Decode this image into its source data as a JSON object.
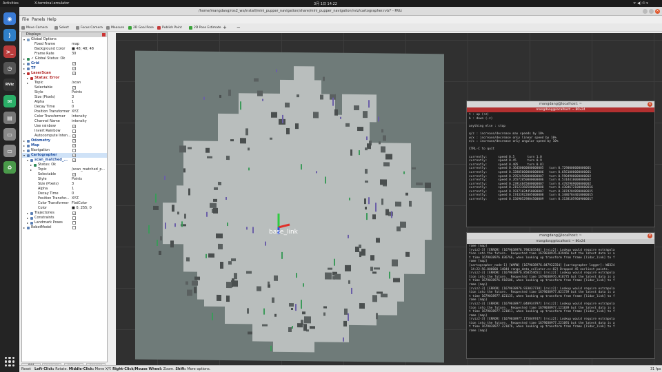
{
  "topbar": {
    "activities": "Activities",
    "app": "X-terminal-emulator",
    "clock": "3月 1日 14:22",
    "right_icons": "ᯤ ◀) ⏻ ▾"
  },
  "dock": {
    "items": [
      {
        "name": "chrome-icon",
        "glyph": "◉",
        "color": "#3a7bd5"
      },
      {
        "name": "vscode-icon",
        "glyph": "⟩",
        "color": "#2f7fc8"
      },
      {
        "name": "terminal-icon",
        "glyph": ">_",
        "color": "#b93c3c"
      },
      {
        "name": "clock-icon",
        "glyph": "◷",
        "color": "#555"
      },
      {
        "name": "rviz-icon",
        "glyph": "RViz",
        "color": "#333"
      },
      {
        "name": "wechat-icon",
        "glyph": "✉",
        "color": "#2aae67"
      },
      {
        "name": "files-icon",
        "glyph": "▤",
        "color": "#777"
      },
      {
        "name": "drive-icon",
        "glyph": "▭",
        "color": "#888"
      },
      {
        "name": "drive-icon-2",
        "glyph": "▭",
        "color": "#888"
      },
      {
        "name": "trash-icon",
        "glyph": "♻",
        "color": "#4a9a4a"
      }
    ]
  },
  "window": {
    "title": "/home/mangdang/ros2_ws/install/mini_pupper_navigation/share/mini_pupper_navigation/rviz/cartographer.rviz* - RViz"
  },
  "menu": {
    "file": "File",
    "panels": "Panels",
    "help": "Help"
  },
  "toolbar": {
    "items": [
      "Move Camera",
      "Select",
      "Focus Camera",
      "Measure",
      "2D Goal Pose",
      "Publish Point",
      "2D Pose Estimate",
      "+",
      "−"
    ],
    "colors": [
      "#888888",
      "#888888",
      "#888888",
      "#888888",
      "#3aa33a",
      "#c43b3b",
      "#3aa33a",
      "#333333",
      "#333333"
    ]
  },
  "displays": {
    "title": "Displays",
    "rows": [
      {
        "indent": 1,
        "arrow": "▾",
        "icon": "#7a9cc2",
        "label": "Global Options",
        "value": ""
      },
      {
        "indent": 2,
        "label": "Fixed Frame",
        "value": "map"
      },
      {
        "indent": 2,
        "label": "Background Color",
        "value": "■ 48; 48; 48",
        "valcolor": "#303030"
      },
      {
        "indent": 2,
        "label": "Frame Rate",
        "value": "30"
      },
      {
        "indent": 1,
        "arrow": "▸",
        "icon": "#2e8b57",
        "label": "✓ Global Status: Ok",
        "value": ""
      },
      {
        "indent": 1,
        "arrow": "▸",
        "icon": "#5a7fb5",
        "label": "Grid",
        "value": "",
        "check": "✓",
        "blue": true
      },
      {
        "indent": 1,
        "arrow": "▸",
        "icon": "#5a7fb5",
        "label": "TF",
        "value": "",
        "check": "✓",
        "blue": true
      },
      {
        "indent": 1,
        "arrow": "▾",
        "icon": "#c03030",
        "label": "LaserScan",
        "value": "",
        "check": "✓",
        "red": true
      },
      {
        "indent": 2,
        "arrow": "▸",
        "icon": "#c03030",
        "label": "Status: Error",
        "value": "",
        "red": true
      },
      {
        "indent": 2,
        "arrow": "▸",
        "label": "Topic",
        "value": "/scan"
      },
      {
        "indent": 2,
        "label": "Selectable",
        "value": "",
        "check": "✓"
      },
      {
        "indent": 2,
        "label": "Style",
        "value": "Points"
      },
      {
        "indent": 2,
        "label": "Size (Pixels)",
        "value": "3"
      },
      {
        "indent": 2,
        "label": "Alpha",
        "value": "1"
      },
      {
        "indent": 2,
        "label": "Decay Time",
        "value": "0"
      },
      {
        "indent": 2,
        "label": "Position Transformer",
        "value": "XYZ"
      },
      {
        "indent": 2,
        "label": "Color Transformer",
        "value": "Intensity"
      },
      {
        "indent": 2,
        "label": "Channel Name",
        "value": "intensity"
      },
      {
        "indent": 2,
        "label": "Use rainbow",
        "value": "",
        "check": "✓"
      },
      {
        "indent": 2,
        "label": "Invert Rainbow",
        "value": "",
        "check": " "
      },
      {
        "indent": 2,
        "label": "Autocompute Inten...",
        "value": "",
        "check": "✓"
      },
      {
        "indent": 1,
        "arrow": "▸",
        "icon": "#5a7fb5",
        "label": "Odometry",
        "value": "",
        "check": "✓",
        "blue": true
      },
      {
        "indent": 1,
        "arrow": "▸",
        "icon": "#5a7fb5",
        "label": "Map",
        "value": "",
        "check": "✓",
        "blue": true
      },
      {
        "indent": 1,
        "arrow": "▸",
        "icon": "#5a7fb5",
        "label": "Navigation",
        "value": "",
        "check": " "
      },
      {
        "indent": 1,
        "arrow": "▾",
        "icon": "#5a7fb5",
        "label": "Cartographer",
        "value": "",
        "check": "✓",
        "blue": true,
        "sel": true
      },
      {
        "indent": 2,
        "arrow": "▾",
        "icon": "#5a7fb5",
        "label": "scan_matched_...",
        "value": "",
        "check": "✓",
        "blue": true
      },
      {
        "indent": 3,
        "arrow": "▸",
        "icon": "#2e8b57",
        "label": "Status: Ok",
        "value": ""
      },
      {
        "indent": 3,
        "arrow": "▸",
        "label": "Topic",
        "value": "/scan_matched_p..."
      },
      {
        "indent": 3,
        "label": "Selectable",
        "value": "",
        "check": "✓"
      },
      {
        "indent": 3,
        "label": "Style",
        "value": "Points"
      },
      {
        "indent": 3,
        "label": "Size (Pixels)",
        "value": "3"
      },
      {
        "indent": 3,
        "label": "Alpha",
        "value": "1"
      },
      {
        "indent": 3,
        "label": "Decay Time",
        "value": "0"
      },
      {
        "indent": 3,
        "label": "Position Transfor...",
        "value": "XYZ"
      },
      {
        "indent": 3,
        "label": "Color Transformer",
        "value": "FlatColor"
      },
      {
        "indent": 3,
        "label": "Color",
        "value": "■ 0; 255; 0",
        "valcolor": "#00ff00"
      },
      {
        "indent": 2,
        "arrow": "▸",
        "icon": "#5a7fb5",
        "label": "Trajectories",
        "value": "",
        "check": "✓"
      },
      {
        "indent": 2,
        "arrow": "▸",
        "icon": "#5a7fb5",
        "label": "Constraints",
        "value": "",
        "check": " "
      },
      {
        "indent": 2,
        "arrow": "▸",
        "icon": "#5a7fb5",
        "label": "Landmark Poses",
        "value": "",
        "check": " "
      },
      {
        "indent": 1,
        "arrow": "▸",
        "icon": "#5a7fb5",
        "label": "RobotModel",
        "value": "",
        "check": " "
      }
    ]
  },
  "panel_buttons": [
    "Add",
    "Duplicate",
    "Remove",
    "Rename"
  ],
  "viewport": {
    "frame_label": "base_link"
  },
  "statusbar": {
    "reset": "Reset",
    "hint_left_key": "Left-Click:",
    "hint_left": " Rotate. ",
    "hint_mid_key": "Middle-Click:",
    "hint_mid": " Move X/Y. ",
    "hint_right_key": "Right-Click/Mouse Wheel:",
    "hint_right": " Zoom. ",
    "hint_shift_key": "Shift:",
    "hint_shift": " More options.",
    "fps": "31 fps"
  },
  "terminal1": {
    "title": "mangdang@localhost: ~",
    "tab": "mangdang@localhost: ~ 80x24",
    "lines": [
      "t : up (+z)",
      "b : down (-z)",
      "",
      "anything else : stop",
      "",
      "q/z : increase/decrease max speeds by 10%",
      "w/x : increase/decrease only linear speed by 10%",
      "e/c : increase/decrease only angular speed by 10%",
      "",
      "CTRL-C to quit",
      "",
      "currently:      speed 0.5       turn 1.0",
      "currently:      speed 0.45      turn 0.9",
      "currently:      speed 0.405     turn 0.81",
      "currently:      speed 0.36450000000000005   turn 0.7290000000000001",
      "currently:      speed 0.32805000000000006   turn 0.6561000000000001",
      "currently:      speed 0.29524500000000007   turn 0.5904900000000002",
      "currently:      speed 0.26572050000000006   turn 0.5314410000000002",
      "currently:      speed 0.23914845000000007   turn 0.4782969000000002",
      "currently:      speed 0.21523360500000008   turn 0.43046721000000016",
      "currently:      speed 0.19371024450000007   turn 0.38742048900000015",
      "currently:      speed 0.17433922005000008   turn 0.34867844010000015",
      "currently:      speed 0.15690529804500009   turn 0.31381059609000017"
    ]
  },
  "terminal2": {
    "title": "mangdang@localhost: ~",
    "tab": "mangdang@localhost: ~ 80x24",
    "lines": [
      "rame [map]",
      "[rviz2-3] [ERROR] [1679038976.798203540] [rviz2]: Lookup would require extrapola",
      "tion into the future.  Requested time 1679038976.839466 but the latest data is a",
      "t time 1679038976.836766, when looking up transform from frame [lidar_link] to f",
      "rame [map]",
      "[cartographer_node-1] [WARN] [1679038976.847922354] [cartographer logger]: W0324",
      " 14:22:56.000000 14844 range_data_collator.cc:82] Dropped 45 earliest points.",
      "[rviz2-3] [ERROR] [1679038976.850354651] [rviz2]: Lookup would require extrapola",
      "tion into the future.  Requested time 1679038976.918775 but the latest data is a",
      "t time 1679038976.916506, when looking up transform from frame [lidar_link] to f",
      "rame [map]",
      "[rviz2-3] [ERROR] [1679038976.933037738] [rviz2]: Lookup would require extrapola",
      "tion into the future.  Requested time 1679038977.021739 but the latest data is a",
      "t time 1679038977.021135, when looking up transform from frame [lidar_link] to f",
      "rame [map]",
      "[rviz2-3] [ERROR] [1679038977.040934797] [rviz2]: Lookup would require extrapola",
      "tion into the future.  Requested time 1679038977.121839 but the latest data is a",
      "t time 1679038977.121011, when looking up transform from frame [lidar_link] to f",
      "rame [map]",
      "[rviz2-3] [ERROR] [1679038977.175849747] [rviz2]: Lookup would require extrapola",
      "tion into the future.  Requested time 1679038977.221091 but the latest data is a",
      "t time 1679038977.221076, when looking up transform from frame [lidar_link] to f",
      "rame [map]"
    ]
  }
}
